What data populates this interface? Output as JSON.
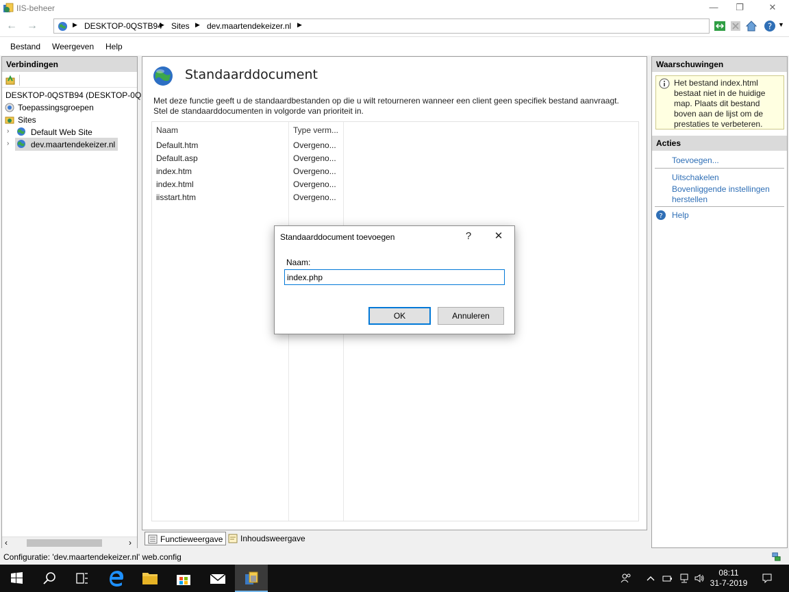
{
  "window": {
    "title": "IIS-beheer"
  },
  "address": {
    "crumbs": [
      "DESKTOP-0QSTB94",
      "Sites",
      "dev.maartendekeizer.nl"
    ]
  },
  "menu": [
    "Bestand",
    "Weergeven",
    "Help"
  ],
  "connections": {
    "header": "Verbindingen",
    "tree": {
      "server": "DESKTOP-0QSTB94 (DESKTOP-0QSTB",
      "app_pools": "Toepassingsgroepen",
      "sites": "Sites",
      "site1": "Default Web Site",
      "site2": "dev.maartendekeizer.nl"
    }
  },
  "feature": {
    "title": "Standaarddocument",
    "description": "Met deze functie geeft u de standaardbestanden op die u wilt retourneren wanneer een client geen specifiek bestand aanvraagt. Stel de standaarddocumenten in volgorde van prioriteit in.",
    "columns": [
      "Naam",
      "Type verm..."
    ],
    "rows": [
      {
        "name": "Default.htm",
        "type": "Overgeno..."
      },
      {
        "name": "Default.asp",
        "type": "Overgeno..."
      },
      {
        "name": "index.htm",
        "type": "Overgeno..."
      },
      {
        "name": "index.html",
        "type": "Overgeno..."
      },
      {
        "name": "iisstart.htm",
        "type": "Overgeno..."
      }
    ]
  },
  "view_tabs": [
    "Functieweergave",
    "Inhoudsweergave"
  ],
  "right_panel": {
    "warnings_header": "Waarschuwingen",
    "warning_text": "Het bestand index.html bestaat niet in de huidige map. Plaats dit bestand boven aan de lijst om de prestaties te verbeteren.",
    "actions_header": "Acties",
    "actions": {
      "add": "Toevoegen...",
      "disable": "Uitschakelen",
      "restore": "Bovenliggende instellingen herstellen",
      "help": "Help"
    }
  },
  "status": {
    "text": "Configuratie: 'dev.maartendekeizer.nl' web.config"
  },
  "dialog": {
    "title": "Standaarddocument toevoegen",
    "help_glyph": "?",
    "label": "Naam:",
    "input_value": "index.php",
    "ok": "OK",
    "cancel": "Annuleren"
  },
  "taskbar": {
    "time": "08:11",
    "date": "31-7-2019"
  },
  "colors": {
    "accent": "#0078d7",
    "link": "#2f6fb6",
    "warning_bg": "#ffffe1",
    "taskbar": "#101010"
  }
}
